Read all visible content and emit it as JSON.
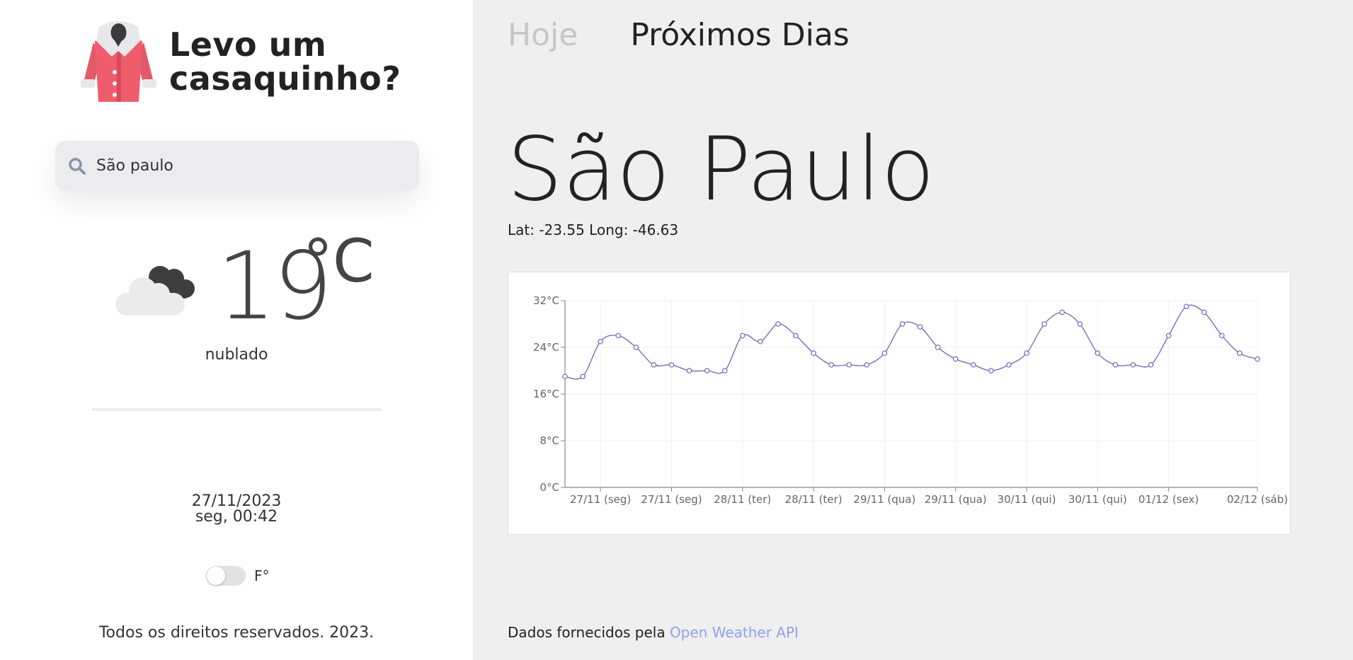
{
  "app": {
    "title_line1": "Levo um",
    "title_line2": "casaquinho?",
    "logo_icon": "coat-icon"
  },
  "search": {
    "icon": "search-icon",
    "value": "São paulo"
  },
  "current": {
    "icon": "cloudy-icon",
    "temperature": "19",
    "unit": "°C",
    "condition": "nublado",
    "date": "27/11/2023",
    "day_time": "seg, 00:42",
    "toggle_label": "F°",
    "toggle_on": false
  },
  "footer": {
    "copyright": "Todos os direitos reservados. 2023.",
    "credit_prefix": "Dados fornecidos pela",
    "credit_link": "Open Weather API"
  },
  "tabs": {
    "today": "Hoje",
    "next_days": "Próximos Dias",
    "active": "next_days"
  },
  "location": {
    "city": "São Paulo",
    "coords": "Lat: -23.55 Long: -46.63"
  },
  "colors": {
    "line": "#6a66b8",
    "link": "#8fa2ec",
    "grid": "#f0f0f0",
    "axis": "#888888"
  },
  "chart_data": {
    "type": "line",
    "ylim": [
      0,
      32
    ],
    "yticks": [
      0,
      8,
      16,
      24,
      32
    ],
    "ytick_labels": [
      "0°C",
      "8°C",
      "16°C",
      "24°C",
      "32°C"
    ],
    "xtick_labels": [
      "27/11 (seg)",
      "27/11 (seg)",
      "28/11 (ter)",
      "28/11 (ter)",
      "29/11 (qua)",
      "29/11 (qua)",
      "30/11 (qui)",
      "30/11 (qui)",
      "01/12 (sex)",
      "02/12 (sáb)"
    ],
    "series": [
      {
        "values": [
          19,
          19,
          25,
          26,
          24,
          21,
          21,
          20,
          20,
          20,
          26,
          25,
          28,
          26,
          23,
          21,
          21,
          21,
          23,
          28,
          27.5,
          24,
          22,
          21,
          20,
          21,
          23,
          28,
          30,
          28,
          23,
          21,
          21,
          21,
          26,
          31,
          30,
          26,
          23,
          22
        ]
      }
    ],
    "grid": true
  }
}
